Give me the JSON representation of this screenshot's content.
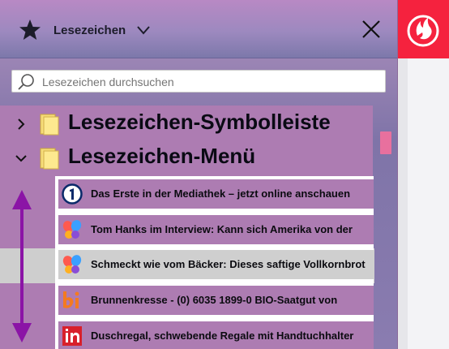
{
  "sidebar": {
    "header": {
      "title": "Lesezeichen",
      "icon": "star-icon"
    },
    "search": {
      "placeholder": "Lesezeichen durchsuchen"
    },
    "tree": [
      {
        "label": "Lesezeichen-Symbolleiste",
        "expanded": false
      },
      {
        "label": "Lesezeichen-Menü",
        "expanded": true
      }
    ],
    "bookmarks": [
      {
        "label": "Das Erste in der Mediathek – jetzt online anschauen",
        "icon": "ard-icon"
      },
      {
        "label": "Tom Hanks im Interview: Kann sich Amerika von der",
        "icon": "butterfly-icon"
      },
      {
        "label": "Schmeckt wie vom Bäcker: Dieses saftige Vollkornbrot",
        "icon": "butterfly-icon"
      },
      {
        "label": "Brunnenkresse - (0) 6035 1899-0  BIO-Saatgut von",
        "icon": "bi-icon"
      },
      {
        "label": "Duschregal, schwebende Regale mit Handtuchhalter",
        "icon": "in-icon"
      }
    ]
  },
  "colors": {
    "accent_tile": "#f5223e",
    "highlight_row": "#cfcfcf",
    "arrow": "#8b14a6",
    "scroll_thumb": "#e8709e"
  }
}
